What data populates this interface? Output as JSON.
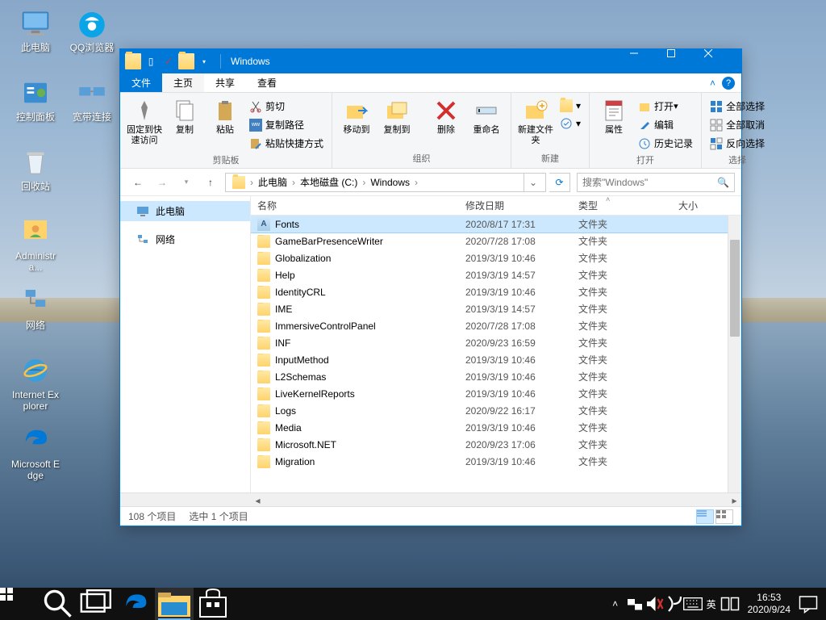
{
  "desktop": {
    "icons": [
      {
        "label": "此电脑",
        "icon": "pc"
      },
      {
        "label": "QQ浏览器",
        "icon": "qq"
      },
      {
        "label": "控制面板",
        "icon": "cpl"
      },
      {
        "label": "宽带连接",
        "icon": "net"
      },
      {
        "label": "回收站",
        "icon": "bin"
      },
      {
        "label": "Administra...",
        "icon": "user"
      },
      {
        "label": "网络",
        "icon": "network"
      },
      {
        "label": "Internet Explorer",
        "icon": "ie"
      },
      {
        "label": "Microsoft Edge",
        "icon": "edge"
      }
    ]
  },
  "window": {
    "title": "Windows",
    "tabs": {
      "file": "文件",
      "home": "主页",
      "share": "共享",
      "view": "查看"
    },
    "ribbon": {
      "clipboard": {
        "label": "剪贴板",
        "pin": "固定到快速访问",
        "copy": "复制",
        "paste": "粘贴",
        "cut": "剪切",
        "copypath": "复制路径",
        "pasteshortcut": "粘贴快捷方式"
      },
      "organize": {
        "label": "组织",
        "moveto": "移动到",
        "copyto": "复制到",
        "delete": "删除",
        "rename": "重命名"
      },
      "new": {
        "label": "新建",
        "newfolder": "新建文件夹"
      },
      "open": {
        "label": "打开",
        "props": "属性",
        "open": "打开",
        "edit": "编辑",
        "history": "历史记录"
      },
      "select": {
        "label": "选择",
        "all": "全部选择",
        "none": "全部取消",
        "invert": "反向选择"
      }
    },
    "breadcrumb": [
      "此电脑",
      "本地磁盘 (C:)",
      "Windows"
    ],
    "search_placeholder": "搜索\"Windows\"",
    "sidebar": {
      "thispc": "此电脑",
      "network": "网络"
    },
    "columns": {
      "name": "名称",
      "date": "修改日期",
      "type": "类型",
      "size": "大小"
    },
    "files": [
      {
        "name": "Fonts",
        "date": "2020/8/17 17:31",
        "type": "文件夹",
        "icon": "fonts",
        "selected": true
      },
      {
        "name": "GameBarPresenceWriter",
        "date": "2020/7/28 17:08",
        "type": "文件夹"
      },
      {
        "name": "Globalization",
        "date": "2019/3/19 10:46",
        "type": "文件夹"
      },
      {
        "name": "Help",
        "date": "2019/3/19 14:57",
        "type": "文件夹"
      },
      {
        "name": "IdentityCRL",
        "date": "2019/3/19 10:46",
        "type": "文件夹"
      },
      {
        "name": "IME",
        "date": "2019/3/19 14:57",
        "type": "文件夹"
      },
      {
        "name": "ImmersiveControlPanel",
        "date": "2020/7/28 17:08",
        "type": "文件夹"
      },
      {
        "name": "INF",
        "date": "2020/9/23 16:59",
        "type": "文件夹"
      },
      {
        "name": "InputMethod",
        "date": "2019/3/19 10:46",
        "type": "文件夹"
      },
      {
        "name": "L2Schemas",
        "date": "2019/3/19 10:46",
        "type": "文件夹"
      },
      {
        "name": "LiveKernelReports",
        "date": "2019/3/19 10:46",
        "type": "文件夹"
      },
      {
        "name": "Logs",
        "date": "2020/9/22 16:17",
        "type": "文件夹"
      },
      {
        "name": "Media",
        "date": "2019/3/19 10:46",
        "type": "文件夹"
      },
      {
        "name": "Microsoft.NET",
        "date": "2020/9/23 17:06",
        "type": "文件夹"
      },
      {
        "name": "Migration",
        "date": "2019/3/19 10:46",
        "type": "文件夹"
      }
    ],
    "status": {
      "count": "108 个项目",
      "selected": "选中 1 个项目"
    }
  },
  "taskbar": {
    "time": "16:53",
    "date": "2020/9/24",
    "ime": "英"
  }
}
